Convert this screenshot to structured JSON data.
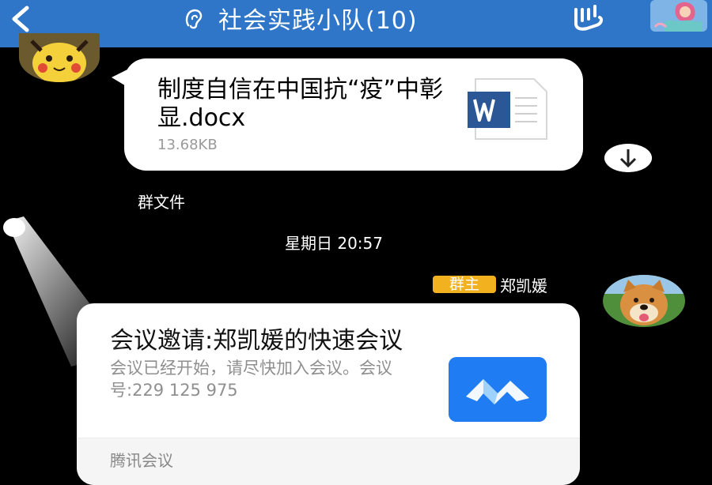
{
  "header": {
    "title": "社会实践小队(10)",
    "icons": [
      "back-arrow-icon",
      "ear-icon",
      "hand-icon",
      "mermaid-avatar"
    ],
    "background": "#2f76c8"
  },
  "messages": {
    "file": {
      "name": "制度自信在中国抗“疫”中彰显.docx",
      "size": "13.68KB",
      "icon": "word-file-icon",
      "source_label": "群文件"
    },
    "timestamp": "星期日 20:57",
    "meeting": {
      "role_badge": "群主",
      "sender": "郑凯媛",
      "title": "会议邀请:郑凯媛的快速会议",
      "description": "会议已经开始，请尽快加入会议。会议号:229 125 975",
      "source": "腾讯会议",
      "icon": "tencent-meeting-icon"
    }
  },
  "colors": {
    "badge": "#f2b21f",
    "meeting_icon_bg": "#1f7cf2",
    "word_blue": "#2b5797"
  }
}
